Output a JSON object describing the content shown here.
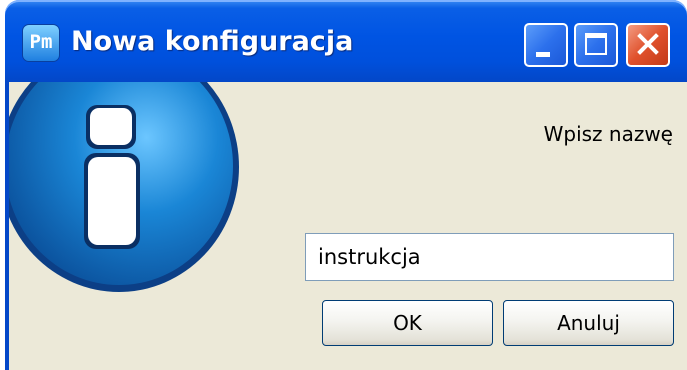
{
  "window": {
    "title": "Nowa konfiguracja",
    "app_icon_text": "Pm",
    "controls": {
      "minimize": "minimize-icon",
      "maximize": "maximize-icon",
      "close": "close-icon"
    }
  },
  "dialog": {
    "prompt": "Wpisz nazwę",
    "input_value": "instrukcja",
    "ok_label": "OK",
    "cancel_label": "Anuluj",
    "icon": "info-icon"
  },
  "colors": {
    "titlebar": "#0054e3",
    "client_bg": "#ece9d8",
    "close_button": "#e0512c",
    "info_icon": "#1a86d6"
  }
}
